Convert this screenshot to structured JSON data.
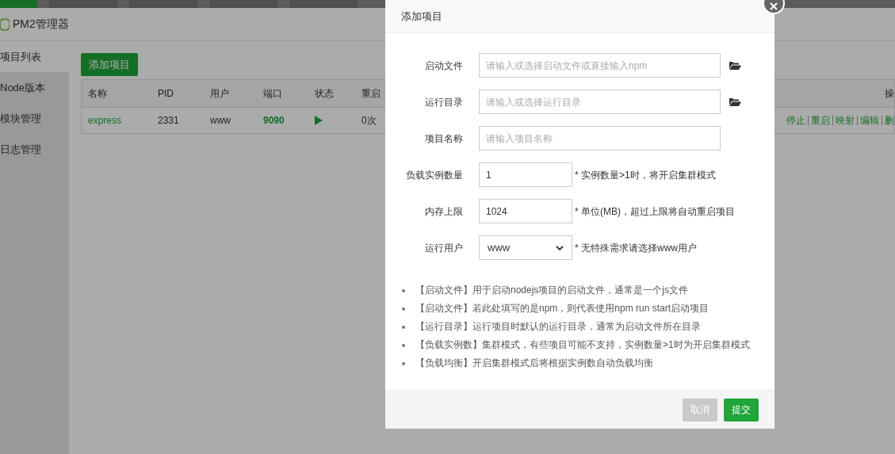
{
  "top_tabs": [
    {
      "selected": true
    },
    {
      "selected": false
    },
    {
      "selected": false
    },
    {
      "selected": false
    },
    {
      "selected": false
    }
  ],
  "app": {
    "title": "PM2管理器"
  },
  "sidebar": {
    "items": [
      {
        "label": "项目列表",
        "selected": true
      },
      {
        "label": "Node版本",
        "selected": false
      },
      {
        "label": "模块管理",
        "selected": false
      },
      {
        "label": "日志管理",
        "selected": false
      }
    ]
  },
  "add_button": "添加项目",
  "table": {
    "columns": [
      "名称",
      "PID",
      "用户",
      "端口",
      "状态",
      "重启",
      "操"
    ],
    "rows": [
      {
        "name": "express",
        "pid": "2331",
        "user": "www",
        "port": "9090",
        "running": true,
        "restarts": "0次",
        "actions": [
          "停止",
          "重启",
          "映射",
          "编辑",
          "删"
        ]
      }
    ]
  },
  "dialog": {
    "title": "添加项目",
    "fields": [
      {
        "kind": "browse",
        "label": "启动文件",
        "placeholder": "请输入或选择启动文件或直接输入npm"
      },
      {
        "kind": "browse",
        "label": "运行目录",
        "placeholder": "请输入或选择运行目录"
      },
      {
        "kind": "text",
        "label": "项目名称",
        "placeholder": "请输入项目名称"
      },
      {
        "kind": "short",
        "label": "负载实例数量",
        "value": "1",
        "hint": "* 实例数量>1时，将开启集群模式"
      },
      {
        "kind": "short",
        "label": "内存上限",
        "value": "1024",
        "hint": "* 单位(MB)，超过上限将自动重启项目"
      },
      {
        "kind": "select",
        "label": "运行用户",
        "value": "www",
        "hint": "* 无特殊需求请选择www用户"
      }
    ],
    "notes": [
      "【启动文件】用于启动nodejs项目的启动文件，通常是一个js文件",
      "【启动文件】若此处填写的是npm，则代表使用npm run start启动项目",
      "【运行目录】运行项目时默认的运行目录，通常为启动文件所在目录",
      "【负载实例数】集群模式，有些项目可能不支持，实例数量>1时为开启集群模式",
      "【负载均衡】开启集群模式后将根据实例数自动负载均衡"
    ],
    "buttons": [
      {
        "label": "取消",
        "disabled": true
      },
      {
        "label": "提交",
        "disabled": false
      }
    ]
  }
}
